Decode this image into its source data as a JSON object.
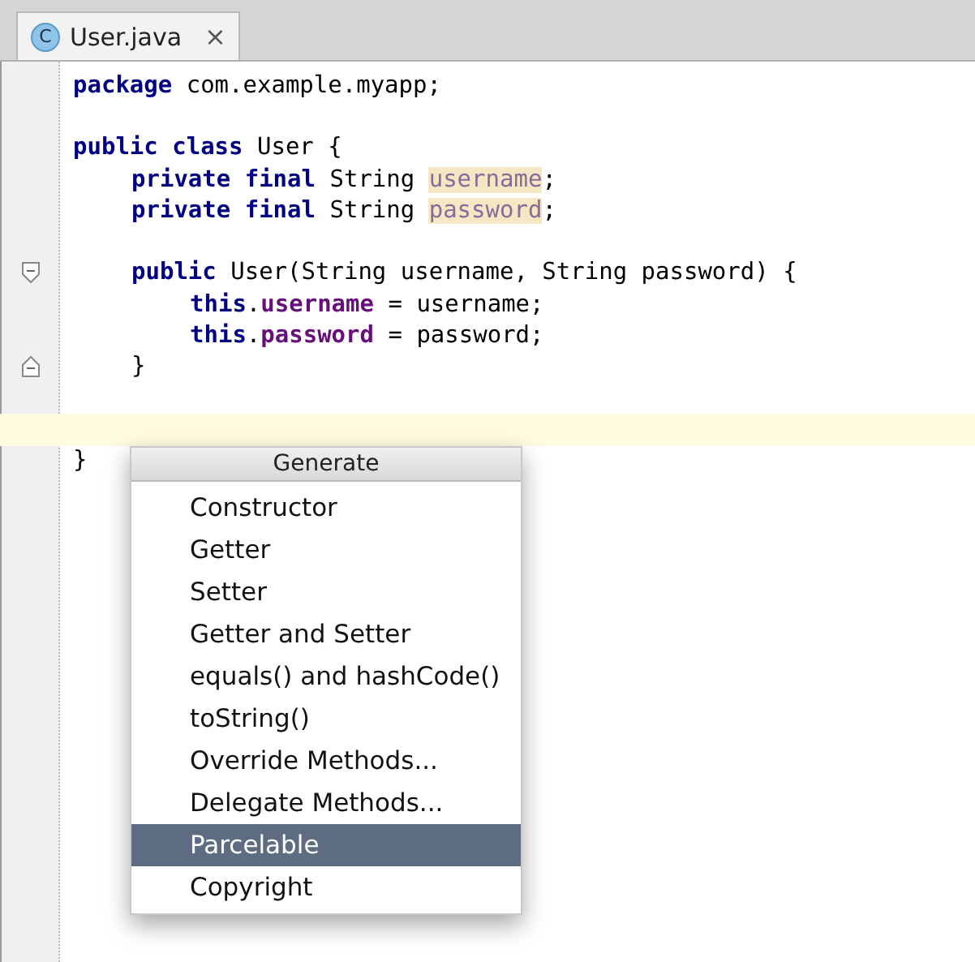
{
  "tabs": [
    {
      "label": "User.java",
      "icon": "C",
      "selected": true,
      "close": "×"
    }
  ],
  "editor": {
    "lines": [
      {
        "kind": "code",
        "current": false,
        "tokens": [
          {
            "kind": "keyword",
            "text": "package"
          },
          {
            "kind": "plain",
            "text": " com.example.myapp;"
          }
        ]
      },
      {
        "kind": "blank",
        "current": false
      },
      {
        "kind": "code",
        "current": false,
        "tokens": [
          {
            "kind": "keyword",
            "text": "public class"
          },
          {
            "kind": "plain",
            "text": " User {"
          }
        ],
        "children": [
          {
            "kind": "code",
            "current": false,
            "tokens": [
              {
                "kind": "keyword",
                "text": "private final"
              },
              {
                "kind": "plain",
                "text": " String "
              },
              {
                "kind": "field-decl",
                "text": "username"
              },
              {
                "kind": "plain",
                "text": ";"
              }
            ]
          },
          {
            "kind": "code",
            "current": false,
            "tokens": [
              {
                "kind": "keyword",
                "text": "private final"
              },
              {
                "kind": "plain",
                "text": " String "
              },
              {
                "kind": "field-decl",
                "text": "password"
              },
              {
                "kind": "plain",
                "text": ";"
              }
            ]
          },
          {
            "kind": "blank",
            "current": false
          },
          {
            "kind": "fold-start",
            "current": false,
            "tokens": [
              {
                "kind": "keyword",
                "text": "public"
              },
              {
                "kind": "plain",
                "text": " User(String username, String password) {"
              }
            ],
            "children": [
              {
                "kind": "code",
                "current": false,
                "tokens": [
                  {
                    "kind": "keyword",
                    "text": "this"
                  },
                  {
                    "kind": "plain",
                    "text": "."
                  },
                  {
                    "kind": "field",
                    "text": "username"
                  },
                  {
                    "kind": "plain",
                    "text": " = username;"
                  }
                ]
              },
              {
                "kind": "code",
                "current": false,
                "tokens": [
                  {
                    "kind": "keyword",
                    "text": "this"
                  },
                  {
                    "kind": "plain",
                    "text": "."
                  },
                  {
                    "kind": "field",
                    "text": "password"
                  },
                  {
                    "kind": "plain",
                    "text": " = password;"
                  }
                ]
              }
            ]
          },
          {
            "kind": "fold-end",
            "current": false,
            "tokens": [
              {
                "kind": "plain",
                "text": "}"
              }
            ]
          },
          {
            "kind": "blank",
            "current": false
          },
          {
            "kind": "blank",
            "current": true
          }
        ]
      },
      {
        "kind": "code",
        "current": false,
        "tokens": [
          {
            "kind": "plain",
            "text": "}"
          }
        ]
      }
    ]
  },
  "popup": {
    "title": "Generate",
    "items": [
      {
        "label": "Constructor",
        "selected": false
      },
      {
        "label": "Getter",
        "selected": false
      },
      {
        "label": "Setter",
        "selected": false
      },
      {
        "label": "Getter and Setter",
        "selected": false
      },
      {
        "label": "equals() and hashCode()",
        "selected": false
      },
      {
        "label": "toString()",
        "selected": false
      },
      {
        "label": "Override Methods...",
        "selected": false
      },
      {
        "label": "Delegate Methods...",
        "selected": false
      },
      {
        "label": "Parcelable",
        "selected": true
      },
      {
        "label": "Copyright",
        "selected": false
      }
    ]
  }
}
